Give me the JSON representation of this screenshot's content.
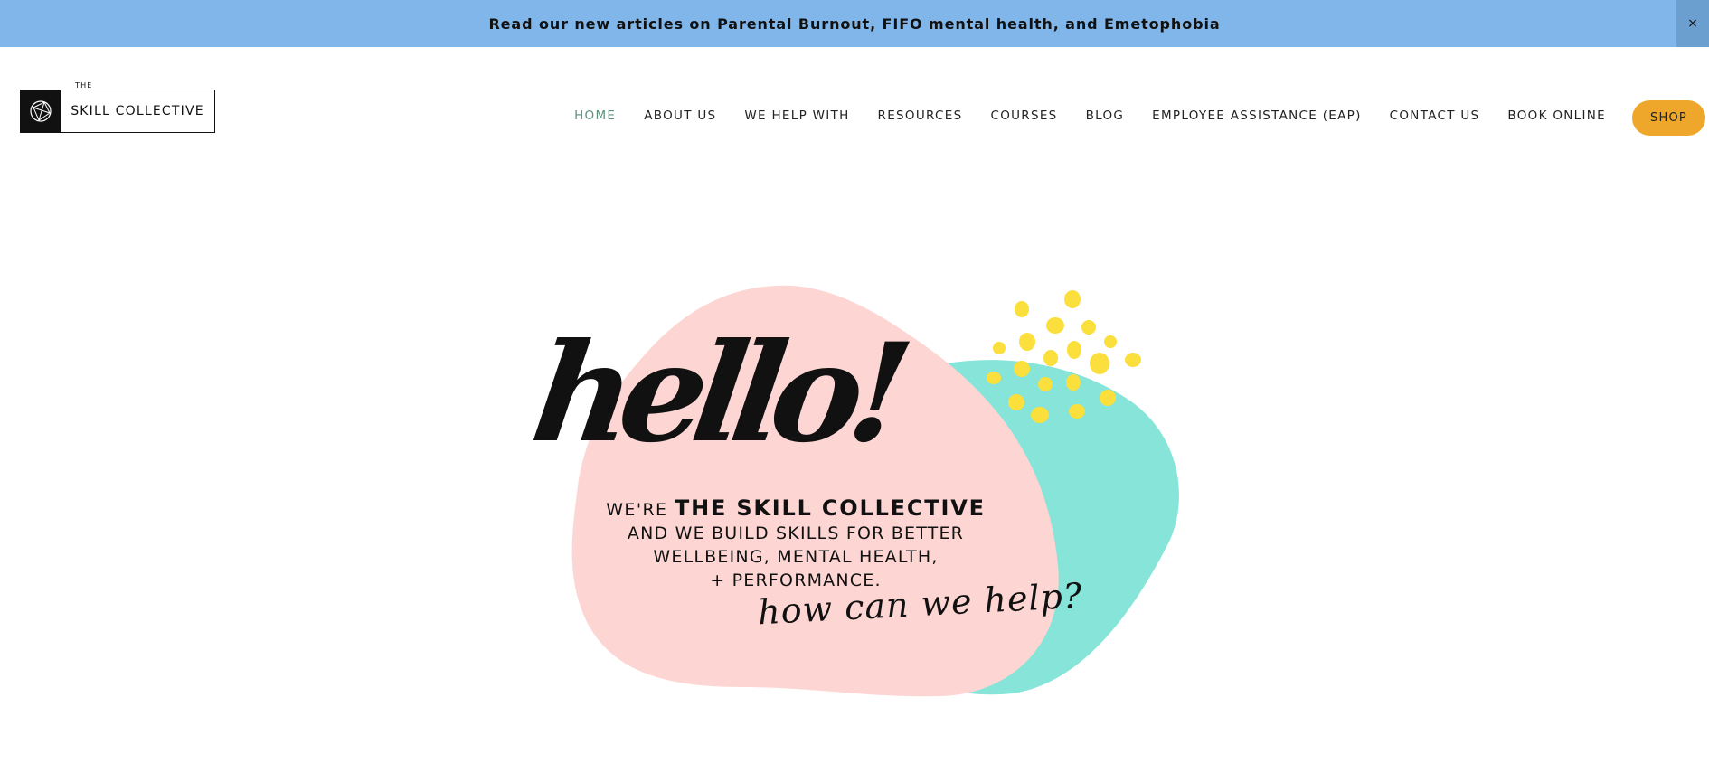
{
  "announcement": {
    "text": "Read our new articles on Parental Burnout, FIFO mental health, and Emetophobia",
    "close_label": "×"
  },
  "logo": {
    "small_text": "THE",
    "name": "SKILL COLLECTIVE",
    "icon": "geometric-logo-icon"
  },
  "nav": {
    "items": [
      {
        "label": "HOME",
        "active": true
      },
      {
        "label": "ABOUT US"
      },
      {
        "label": "WE HELP WITH"
      },
      {
        "label": "RESOURCES"
      },
      {
        "label": "COURSES"
      },
      {
        "label": "BLOG"
      },
      {
        "label": "EMPLOYEE ASSISTANCE (EAP)"
      },
      {
        "label": "CONTACT US"
      },
      {
        "label": "BOOK ONLINE"
      }
    ],
    "shop_label": "SHOP"
  },
  "hero": {
    "hello": "hello!",
    "lead": "WE'RE",
    "brand": "THE SKILL COLLECTIVE",
    "line2": "AND WE BUILD SKILLS FOR BETTER",
    "line3": "WELLBEING, MENTAL HEALTH,",
    "line4": "+ PERFORMANCE.",
    "cta": "how can we help?"
  },
  "colors": {
    "announcement_bg": "#80b6ea",
    "nav_active": "#5c917b",
    "shop_bg": "#eea72a",
    "pink_blob": "#fdd6d4",
    "teal_blob": "#86e4d8",
    "dots": "#fbdf3c"
  }
}
